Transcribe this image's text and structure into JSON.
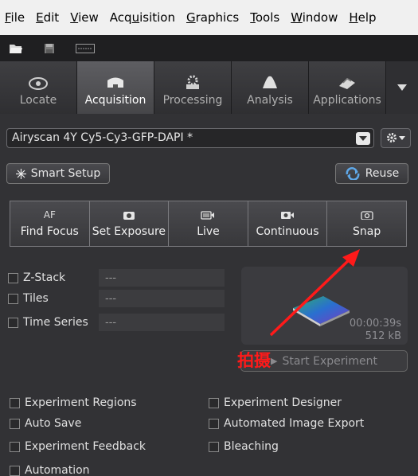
{
  "menu": {
    "items": [
      {
        "acc": "F",
        "rest": "ile"
      },
      {
        "acc": "E",
        "rest": "dit"
      },
      {
        "acc": "V",
        "rest": "iew"
      },
      {
        "pre": "Acq",
        "acc": "u",
        "rest": "isition"
      },
      {
        "acc": "G",
        "rest": "raphics"
      },
      {
        "acc": "T",
        "rest": "ools"
      },
      {
        "acc": "W",
        "rest": "indow"
      },
      {
        "acc": "H",
        "rest": "elp"
      }
    ]
  },
  "toolbar": {
    "icons": [
      "open-folder-icon",
      "save-icon",
      "keyboard-icon"
    ]
  },
  "tabs": [
    {
      "label": "Locate",
      "active": false
    },
    {
      "label": "Acquisition",
      "active": true
    },
    {
      "label": "Processing",
      "active": false
    },
    {
      "label": "Analysis",
      "active": false
    },
    {
      "label": "Applications",
      "active": false
    }
  ],
  "config": {
    "value": "Airyscan 4Y Cy5-Cy3-GFP-DAPI *"
  },
  "buttons": {
    "smart_setup": "Smart Setup",
    "reuse": "Reuse",
    "start_experiment": "Start Experiment"
  },
  "acquisition_buttons": [
    {
      "icon_text": "AF",
      "label": "Find Focus"
    },
    {
      "icon_text": "",
      "label": "Set Exposure"
    },
    {
      "icon_text": "",
      "label": "Live"
    },
    {
      "icon_text": "",
      "label": "Continuous"
    },
    {
      "icon_text": "",
      "label": "Snap"
    }
  ],
  "dimensions": [
    {
      "label": "Z-Stack",
      "value": "---"
    },
    {
      "label": "Tiles",
      "value": "---"
    },
    {
      "label": "Time Series",
      "value": "---"
    }
  ],
  "preview": {
    "time": "00:00:39s",
    "size": "512 kB"
  },
  "annotation": {
    "text": "拍摄",
    "color": "#ff1a1a"
  },
  "options_left": [
    "Experiment Regions",
    "Auto Save",
    "Experiment Feedback",
    "Automation"
  ],
  "options_right": [
    "Experiment Designer",
    "Automated Image Export",
    "Bleaching"
  ]
}
